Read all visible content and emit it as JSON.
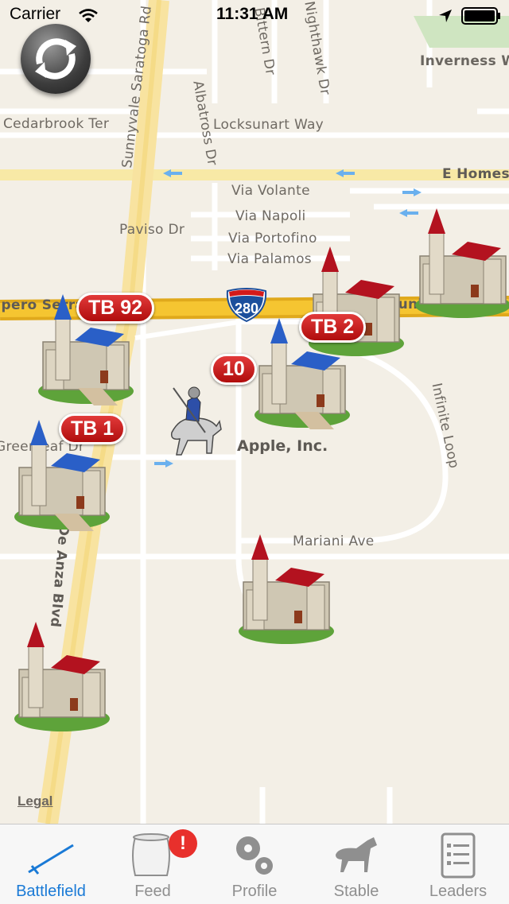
{
  "status_bar": {
    "carrier": "Carrier",
    "time": "11:31 AM"
  },
  "map": {
    "streets": [
      "Sunnyvale Saratoga Rd",
      "Albatross Dr",
      "Bittern Dr",
      "Nighthawk Dr",
      "Inverness W",
      "Cedarbrook Ter",
      "Locksunart Way",
      "E Homes",
      "Via Volante",
      "Via Napoli",
      "Via Portofino",
      "Via Palamos",
      "Paviso Dr",
      "Junipero Serra Fwy",
      "Junipero Serra Fwy",
      "Infinite Loop",
      "Mariani Ave",
      "N De Anza Blvd",
      "Greenleaf Dr"
    ],
    "highway_shield": "280",
    "poi": "Apple, Inc.",
    "legal": "Legal"
  },
  "castles": [
    {
      "label": "TB 92",
      "roof": "blue"
    },
    {
      "label": "TB 2",
      "roof": "blue"
    },
    {
      "label": "10",
      "roof": "blue"
    },
    {
      "label": "TB 1",
      "roof": "blue"
    },
    {
      "label": "",
      "roof": "red"
    },
    {
      "label": "",
      "roof": "red"
    },
    {
      "label": "",
      "roof": "red"
    },
    {
      "label": "",
      "roof": "red"
    }
  ],
  "tabbar": {
    "tabs": [
      {
        "label": "Battlefield",
        "icon": "sword-icon",
        "active": true
      },
      {
        "label": "Feed",
        "icon": "scroll-icon",
        "active": false
      },
      {
        "label": "Profile",
        "icon": "gears-icon",
        "active": false
      },
      {
        "label": "Stable",
        "icon": "horse-icon",
        "active": false
      },
      {
        "label": "Leaders",
        "icon": "list-icon",
        "active": false
      }
    ],
    "feed_badge": "!"
  },
  "colors": {
    "accent": "#1a7ad6",
    "badge": "#c41414",
    "freeway": "#f5c531"
  }
}
